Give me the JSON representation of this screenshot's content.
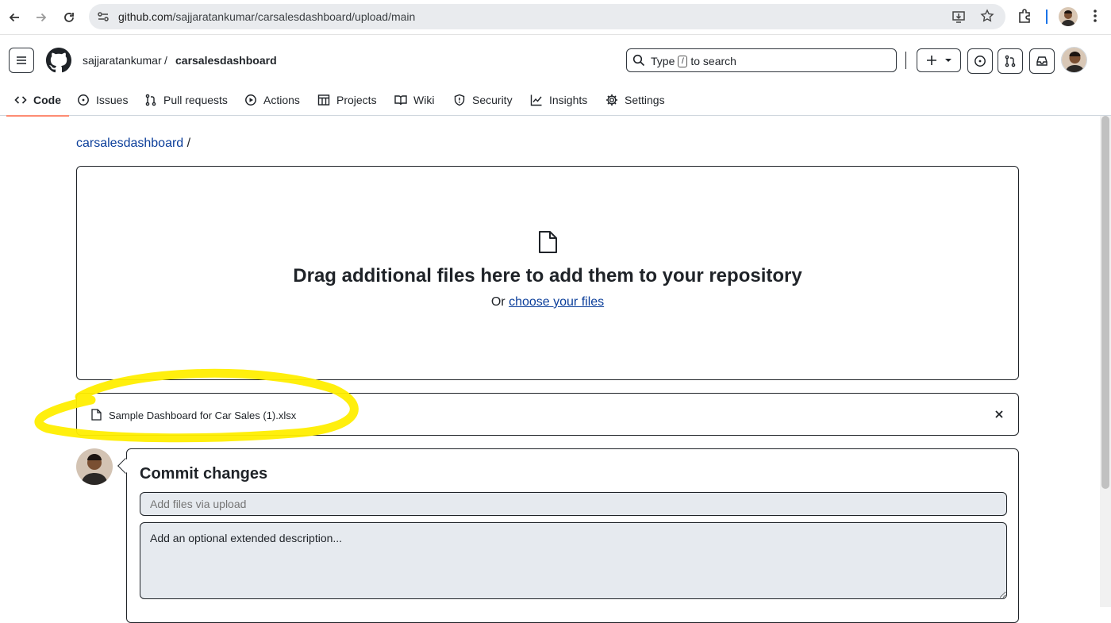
{
  "browser": {
    "url_host": "github.com",
    "url_path": "/sajjaratankumar/carsalesdashboard/upload/main"
  },
  "header": {
    "owner": "sajjaratankumar",
    "separator": "/",
    "repo": "carsalesdashboard",
    "search": {
      "prefix": "Type",
      "key": "/",
      "suffix": "to search"
    }
  },
  "tabs": [
    {
      "label": "Code",
      "icon": "code-icon",
      "active": true
    },
    {
      "label": "Issues",
      "icon": "issue-icon"
    },
    {
      "label": "Pull requests",
      "icon": "pull-request-icon"
    },
    {
      "label": "Actions",
      "icon": "play-icon"
    },
    {
      "label": "Projects",
      "icon": "table-icon"
    },
    {
      "label": "Wiki",
      "icon": "book-icon"
    },
    {
      "label": "Security",
      "icon": "shield-icon"
    },
    {
      "label": "Insights",
      "icon": "graph-icon"
    },
    {
      "label": "Settings",
      "icon": "gear-icon"
    }
  ],
  "main": {
    "breadcrumb_repo": "carsalesdashboard",
    "breadcrumb_sep": "/",
    "drop_title": "Drag additional files here to add them to your repository",
    "drop_or": "Or",
    "drop_link": "choose your files",
    "uploaded_file": "Sample Dashboard for Car Sales (1).xlsx"
  },
  "commit": {
    "title": "Commit changes",
    "summary_placeholder": "Add files via upload",
    "description_placeholder": "Add an optional extended description..."
  },
  "colors": {
    "link": "#0b3e9a",
    "highlight": "#ffee00",
    "active_tab": "#fd8c73"
  }
}
